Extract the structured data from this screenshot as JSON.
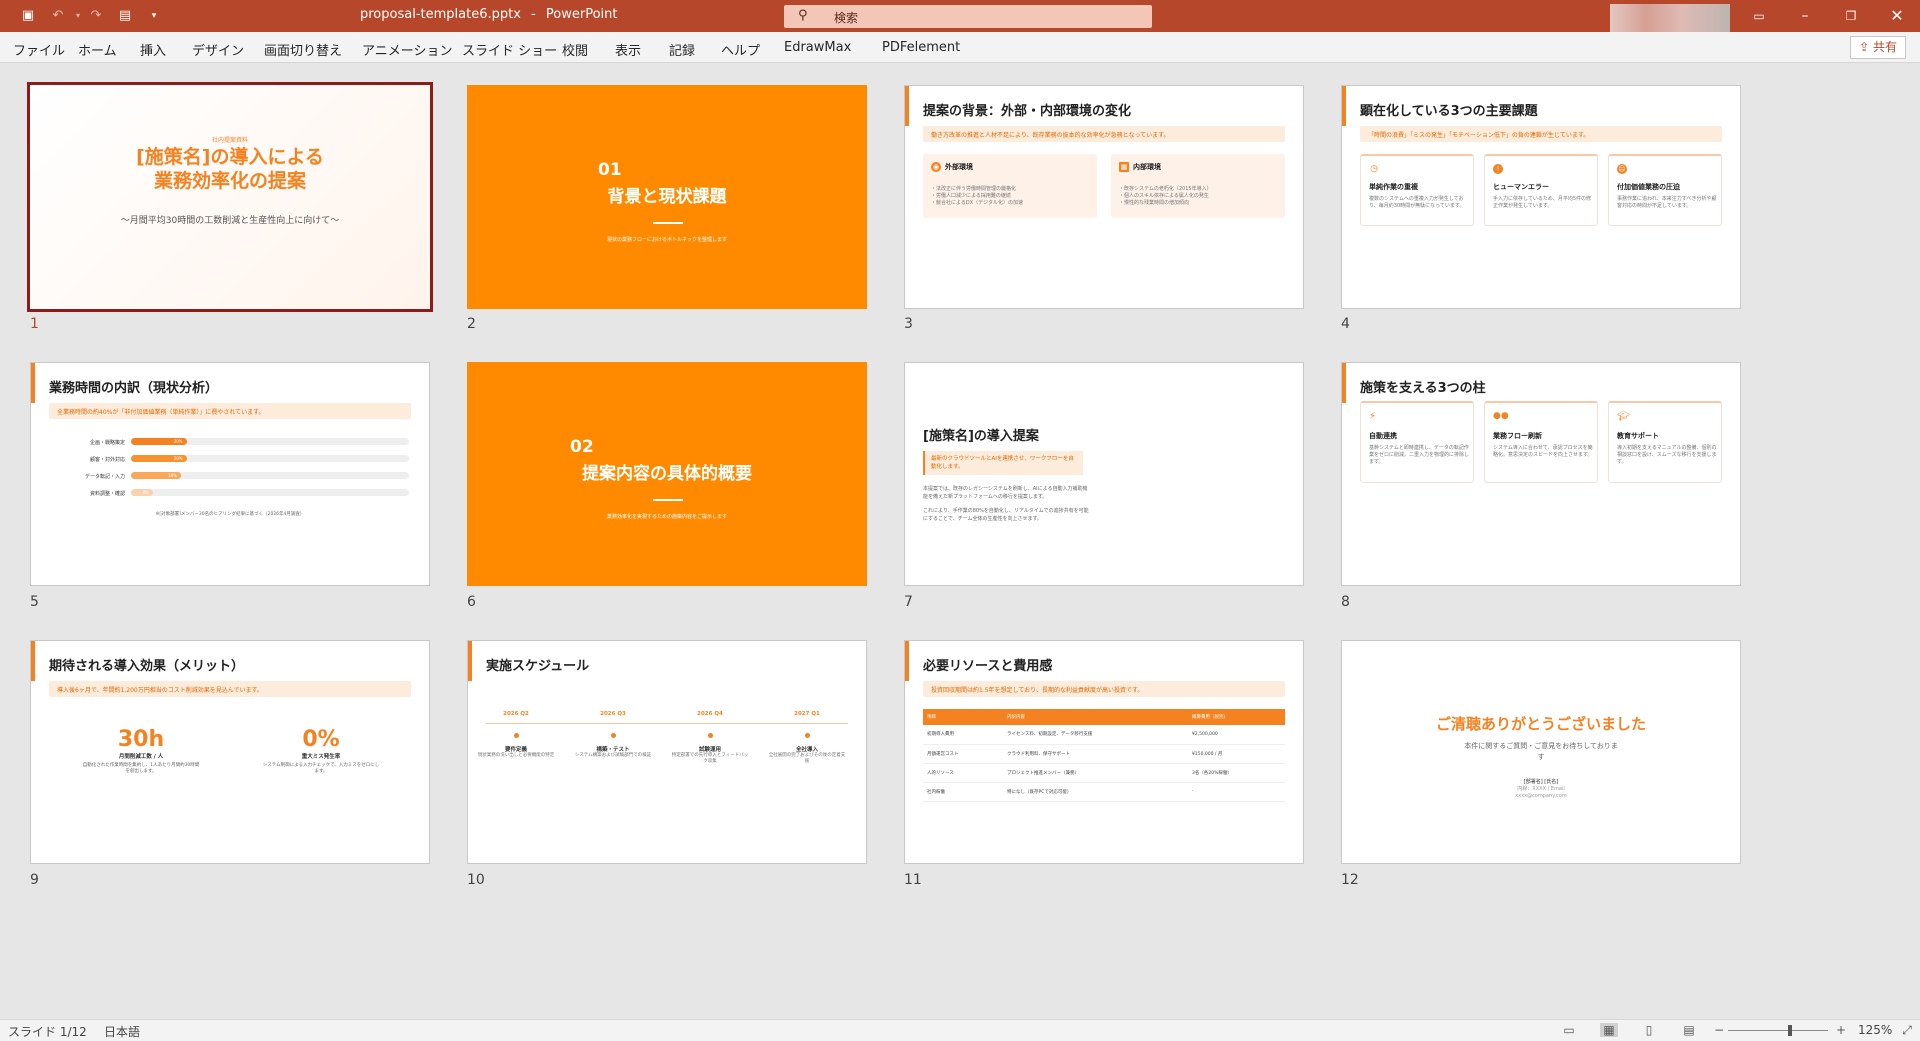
{
  "titlebar": {
    "filename": "proposal-template6.pptx",
    "separator": "-",
    "app": "PowerPoint",
    "search_icon": "magnifier-icon",
    "search_placeholder": "検索"
  },
  "menu": [
    "ファイル",
    "ホーム",
    "挿入",
    "デザイン",
    "画面切り替え",
    "アニメーション",
    "スライド ショー",
    "校閲",
    "表示",
    "記録",
    "ヘルプ",
    "EdrawMax",
    "PDFelement"
  ],
  "share_label": "共有",
  "colors": {
    "accent": "#b7472a",
    "orange": "#f58220",
    "section": "#ff8a00"
  },
  "slides": {
    "s1": {
      "num": "1",
      "sup": "社内提案資料",
      "title_line1": "[施策名]の導入による",
      "title_line2": "業務効率化の提案",
      "subtitle": "〜月間平均30時間の工数削減と生産性向上に向けて〜"
    },
    "s2": {
      "num": "2",
      "section_no": "01",
      "title": "背景と現状課題",
      "desc": "現状の業務フローにおけるボトルネックを整理します"
    },
    "s3": {
      "num": "3",
      "title": "提案の背景：外部・内部環境の変化",
      "band": "働き方改革の推進と人材不足により、既存業務の抜本的な効率化が急務となっています。",
      "card1_title": "外部環境",
      "card1_lines": [
        "・法改正に伴う労働時間管理の厳格化",
        "・労働人口減少による採用難の継続",
        "・競合社によるDX（デジタル化）の加速"
      ],
      "card2_title": "内部環境",
      "card2_lines": [
        "・既存システムの老朽化（2015年導入）",
        "・個人のスキル依存による属人化の発生",
        "・慢性的な残業時間の増加傾向"
      ]
    },
    "s4": {
      "num": "4",
      "title": "顕在化している3つの主要課題",
      "band": "「時間の浪費」「ミスの発生」「モチベーション低下」の負の連鎖が生じています。",
      "cards": [
        {
          "title": "単純作業の重複",
          "text": "複数のシステムへの重複入力が発生しており、毎月約30時間が無駄になっています。"
        },
        {
          "title": "ヒューマンエラー",
          "text": "手入力に依存しているため、月平均5件の修正作業が発生しています。"
        },
        {
          "title": "付加価値業務の圧迫",
          "text": "事務作業に追われ、本来注力すべき分析や顧客対応の時間が不足しています。"
        }
      ]
    },
    "s5": {
      "num": "5",
      "title": "業務時間の内訳（現状分析）",
      "band": "全業務時間の約40%が「非付加価値業務（単純作業）」に費やされています。",
      "note": "※[対象部署]メンバー30名のヒアリング結果に基づく（2026年4月調査）"
    },
    "s6": {
      "num": "6",
      "section_no": "02",
      "title": "提案内容の具体的概要",
      "desc": "業務効率化を実現するための施策内容をご提示します"
    },
    "s7": {
      "num": "7",
      "title": "[施策名]の導入提案",
      "callout": "最新のクラウドツールとAIを連携させ、ワークフローを自動化します。",
      "p1": "本提案では、既存のレガシーシステムを刷新し、AIによる自動入力補助機能を備えた新プラットフォームへの移行を提案します。",
      "p2": "これにより、手作業の80%を自動化し、リアルタイムでの進捗共有を可能にすることで、チーム全体の生産性を向上させます。"
    },
    "s8": {
      "num": "8",
      "title": "施策を支える3つの柱",
      "cards": [
        {
          "title": "自動連携",
          "text": "基幹システムと即時連携し、データの転記作業をゼロに削減。二重入力を物理的に排除します。"
        },
        {
          "title": "業務フロー刷新",
          "text": "システム導入に合わせて、承認プロセスを簡略化。意思決定のスピードを向上させます。"
        },
        {
          "title": "教育サポート",
          "text": "導入初期を支えるマニュアルの整備、個別の相談窓口を設け、スムーズな移行を支援します。"
        }
      ]
    },
    "s9": {
      "num": "9",
      "title": "期待される導入効果（メリット）",
      "band": "導入後6ヶ月で、年間約1,200万円相当のコスト削減効果を見込んでいます。",
      "m1_value": "30h",
      "m1_label": "月間削減工数 / 人",
      "m1_text": "自動化された作業時間を集約し、1人あたり月間約30時間を創出します。",
      "m2_value": "0%",
      "m2_label": "重大ミス発生率",
      "m2_text": "システム制御による入力チェックで、入力ミスをゼロにします。"
    },
    "s10": {
      "num": "10",
      "title": "実施スケジュール",
      "steps": [
        {
          "period": "2026 Q2",
          "name": "要件定義",
          "text": "現状業務の洗い出しと必要機能の特定"
        },
        {
          "period": "2026 Q3",
          "name": "構築・テスト",
          "text": "システム構築および試験部門での検証"
        },
        {
          "period": "2026 Q4",
          "name": "試験運用",
          "text": "特定部署での先行導入とフィードバック収集"
        },
        {
          "period": "2027 Q1",
          "name": "全社導入",
          "text": "全社展開の完了およびその後の定着支援"
        }
      ]
    },
    "s11": {
      "num": "11",
      "title": "必要リソースと費用感",
      "band": "投資回収期間は約1.5年を想定しており、長期的な利益貢献度が高い投資です。",
      "headers": [
        "項目",
        "内訳内容",
        "概算費用（税別）"
      ],
      "rows": [
        [
          "初期導入費用",
          "ライセンス料、初期設定、データ移行支援",
          "¥2,500,000"
        ],
        [
          "月額運営コスト",
          "クラウド利用料、保守サポート",
          "¥150,000 / 月"
        ],
        [
          "人的リソース",
          "プロジェクト推進メンバー（兼務）",
          "3名（各20%稼働）"
        ],
        [
          "社内稼働",
          "特になし（既存PCで対応可能）",
          "-"
        ]
      ]
    },
    "s12": {
      "num": "12",
      "title": "ご清聴ありがとうございました",
      "line1": "本件に関するご質問・ご意見をお待ちしておりま",
      "line2": "す",
      "contact_name": "[部署名] [氏名]",
      "contact_ext": "内線：XXXX / Email",
      "contact_mail": "xxxx@company.com"
    }
  },
  "chart_data": {
    "type": "bar",
    "categories": [
      "企画・戦略策定",
      "顧客・対外対応",
      "データ転記・入力",
      "資料調整・確認"
    ],
    "values": [
      20,
      20,
      18,
      8
    ],
    "labels": [
      "20%",
      "20%",
      "18%",
      "8%"
    ],
    "xlabel": "",
    "ylabel": "",
    "xlim": [
      0,
      100
    ]
  },
  "statusbar": {
    "slide_info": "スライド 1/12",
    "language": "日本語",
    "zoom": "125%"
  }
}
